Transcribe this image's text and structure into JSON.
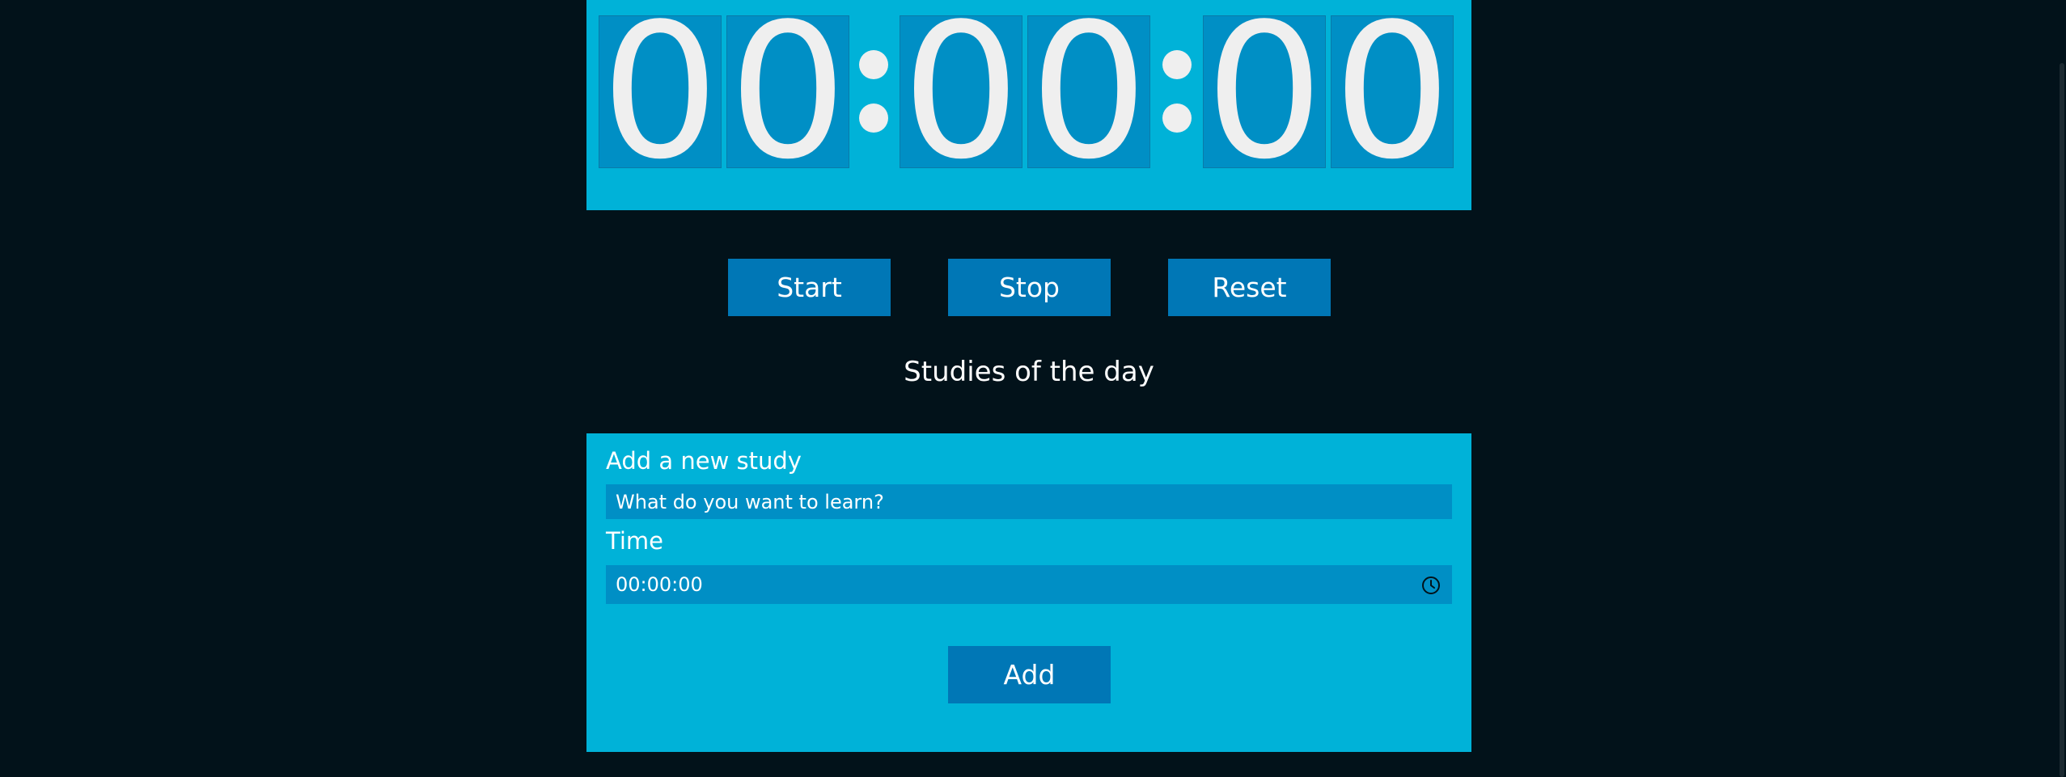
{
  "timer": {
    "digits": [
      "0",
      "0",
      "0",
      "0",
      "0",
      "0"
    ]
  },
  "controls": {
    "start_label": "Start",
    "stop_label": "Stop",
    "reset_label": "Reset"
  },
  "studies": {
    "title": "Studies of the day"
  },
  "form": {
    "heading": "Add a new study",
    "study_placeholder": "What do you want to learn?",
    "time_label": "Time",
    "time_value": "00:00:00",
    "add_label": "Add"
  },
  "colors": {
    "background": "#02121a",
    "panel": "#00b2d8",
    "digit_box": "#008fc5",
    "button": "#0077b6",
    "text": "#f0f0f0"
  },
  "icons": {
    "time_field": "clock-icon"
  }
}
